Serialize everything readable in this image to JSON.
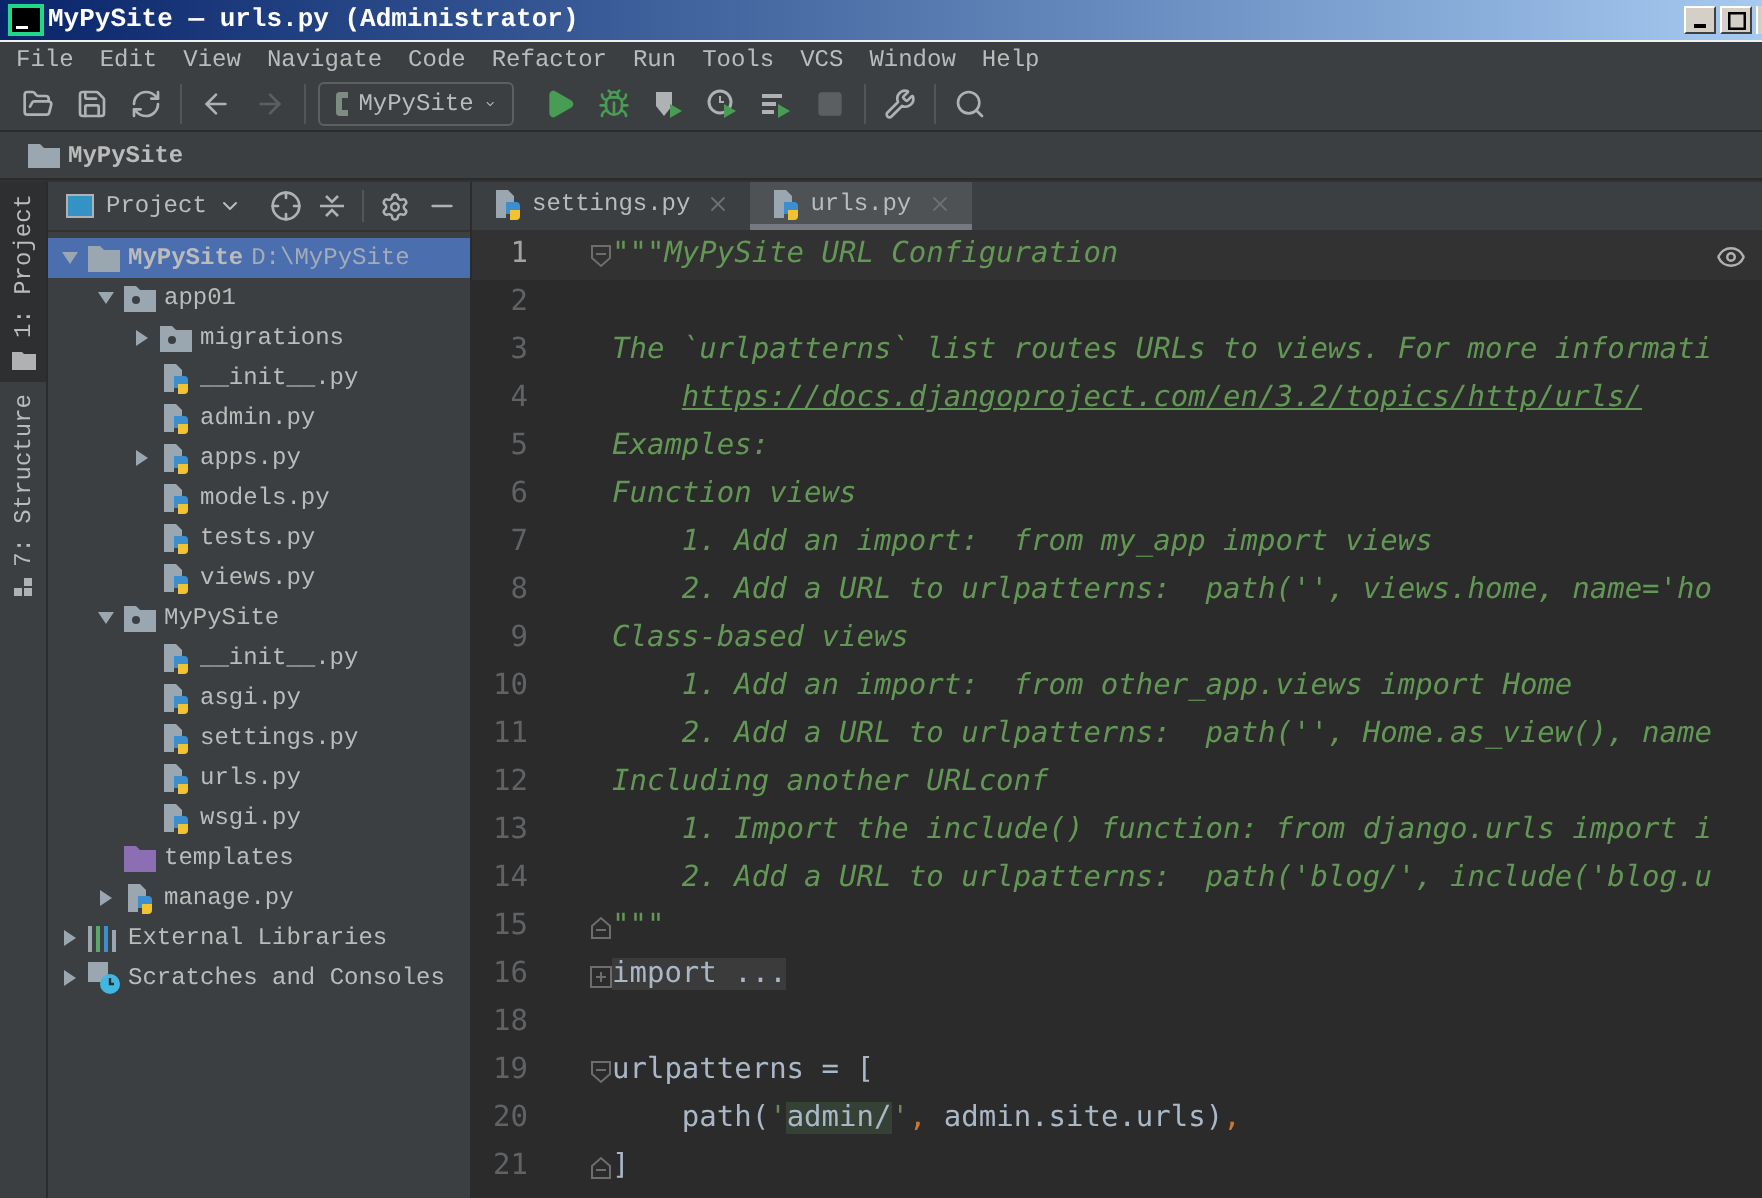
{
  "window": {
    "title": "MyPySite — urls.py (Administrator)"
  },
  "menu": [
    "File",
    "Edit",
    "View",
    "Navigate",
    "Code",
    "Refactor",
    "Run",
    "Tools",
    "VCS",
    "Window",
    "Help"
  ],
  "toolbar": {
    "run_config": "MyPySite"
  },
  "breadcrumb": "MyPySite",
  "tool_windows": [
    {
      "label": "1: Project",
      "selected": true
    },
    {
      "label": "7: Structure",
      "selected": false
    }
  ],
  "project_panel": {
    "title": "Project"
  },
  "tree": [
    {
      "label": "MyPySite",
      "path": "D:\\MyPySite",
      "kind": "folder",
      "expanded": true,
      "selected": true,
      "children": [
        {
          "label": "app01",
          "kind": "package",
          "expanded": true,
          "selected": false,
          "children": [
            {
              "label": "migrations",
              "kind": "package",
              "expanded": false,
              "selected": false
            },
            {
              "label": "__init__.py",
              "kind": "py",
              "selected": false
            },
            {
              "label": "admin.py",
              "kind": "py",
              "selected": false
            },
            {
              "label": "apps.py",
              "kind": "py",
              "expanded": false,
              "selected": false
            },
            {
              "label": "models.py",
              "kind": "py",
              "selected": false
            },
            {
              "label": "tests.py",
              "kind": "py",
              "selected": false
            },
            {
              "label": "views.py",
              "kind": "py",
              "selected": false
            }
          ]
        },
        {
          "label": "MyPySite",
          "kind": "package",
          "expanded": true,
          "selected": false,
          "children": [
            {
              "label": "__init__.py",
              "kind": "py",
              "selected": false
            },
            {
              "label": "asgi.py",
              "kind": "py",
              "selected": false
            },
            {
              "label": "settings.py",
              "kind": "py",
              "selected": false
            },
            {
              "label": "urls.py",
              "kind": "py",
              "selected": false
            },
            {
              "label": "wsgi.py",
              "kind": "py",
              "selected": false
            }
          ]
        },
        {
          "label": "templates",
          "kind": "templates",
          "selected": false
        },
        {
          "label": "manage.py",
          "kind": "py",
          "expanded": false,
          "selected": false
        }
      ]
    },
    {
      "label": "External Libraries",
      "kind": "libraries",
      "expanded": false,
      "selected": false
    },
    {
      "label": "Scratches and Consoles",
      "kind": "scratches",
      "expanded": false,
      "selected": false
    }
  ],
  "tabs": [
    {
      "label": "settings.py",
      "selected": false
    },
    {
      "label": "urls.py",
      "selected": true
    }
  ],
  "editor": {
    "lines": [
      {
        "number": "1",
        "current": true,
        "kind": "foldstart",
        "tokens": [
          {
            "kind": "doc",
            "text": "\"\"\"MyPySite URL Configuration"
          }
        ]
      },
      {
        "number": "2",
        "current": false,
        "kind": "text"
      },
      {
        "number": "3",
        "current": false,
        "kind": "text",
        "tokens": [
          {
            "kind": "doc",
            "text": "The `urlpatterns` list routes URLs to views. For more informati"
          }
        ]
      },
      {
        "number": "4",
        "current": false,
        "kind": "text",
        "indented": true,
        "tokens": [
          {
            "kind": "link",
            "text": "https://docs.djangoproject.com/en/3.2/topics/http/urls/"
          }
        ]
      },
      {
        "number": "5",
        "current": false,
        "kind": "text",
        "tokens": [
          {
            "kind": "doc",
            "text": "Examples:"
          }
        ]
      },
      {
        "number": "6",
        "current": false,
        "kind": "text",
        "tokens": [
          {
            "kind": "doc",
            "text": "Function views"
          }
        ]
      },
      {
        "number": "7",
        "current": false,
        "kind": "text",
        "tokens": [
          {
            "kind": "doc",
            "text": "    1. Add an import:  from my_app import views"
          }
        ]
      },
      {
        "number": "8",
        "current": false,
        "kind": "text",
        "tokens": [
          {
            "kind": "doc",
            "text": "    2. Add a URL to urlpatterns:  path('', views.home, name='ho"
          }
        ]
      },
      {
        "number": "9",
        "current": false,
        "kind": "text",
        "tokens": [
          {
            "kind": "doc",
            "text": "Class-based views"
          }
        ]
      },
      {
        "number": "10",
        "current": false,
        "kind": "text",
        "tokens": [
          {
            "kind": "doc",
            "text": "    1. Add an import:  from other_app.views import Home"
          }
        ]
      },
      {
        "number": "11",
        "current": false,
        "kind": "text",
        "tokens": [
          {
            "kind": "doc",
            "text": "    2. Add a URL to urlpatterns:  path('', Home.as_view(), name"
          }
        ]
      },
      {
        "number": "12",
        "current": false,
        "kind": "text",
        "tokens": [
          {
            "kind": "doc",
            "text": "Including another URLconf"
          }
        ]
      },
      {
        "number": "13",
        "current": false,
        "kind": "text",
        "tokens": [
          {
            "kind": "doc",
            "text": "    1. Import the include() function: from django.urls import i"
          }
        ]
      },
      {
        "number": "14",
        "current": false,
        "kind": "text",
        "tokens": [
          {
            "kind": "doc",
            "text": "    2. Add a URL to urlpatterns:  path('blog/', include('blog.u"
          }
        ]
      },
      {
        "number": "15",
        "current": false,
        "kind": "foldend",
        "tokens": [
          {
            "kind": "doc",
            "text": "\"\"\""
          }
        ]
      },
      {
        "number": "16",
        "current": false,
        "kind": "folded",
        "tokens": [
          {
            "kind": "folded",
            "text": "import ..."
          }
        ]
      },
      {
        "number": "18",
        "current": false,
        "kind": "text"
      },
      {
        "number": "19",
        "current": false,
        "kind": "foldstart",
        "tokens": [
          {
            "kind": "plain",
            "text": "urlpatterns = ["
          }
        ]
      },
      {
        "number": "20",
        "current": false,
        "kind": "text",
        "tokens": [
          {
            "kind": "plain",
            "text": "    path("
          },
          {
            "kind": "str",
            "text": "'"
          },
          {
            "kind": "match",
            "text": "admin/"
          },
          {
            "kind": "str",
            "text": "'"
          },
          {
            "kind": "comma",
            "text": ","
          },
          {
            "kind": "plain",
            "text": " admin.site.urls)"
          },
          {
            "kind": "comma",
            "text": ","
          }
        ]
      },
      {
        "number": "21",
        "current": false,
        "kind": "foldend",
        "tokens": [
          {
            "kind": "plain",
            "text": "]"
          }
        ]
      }
    ]
  }
}
